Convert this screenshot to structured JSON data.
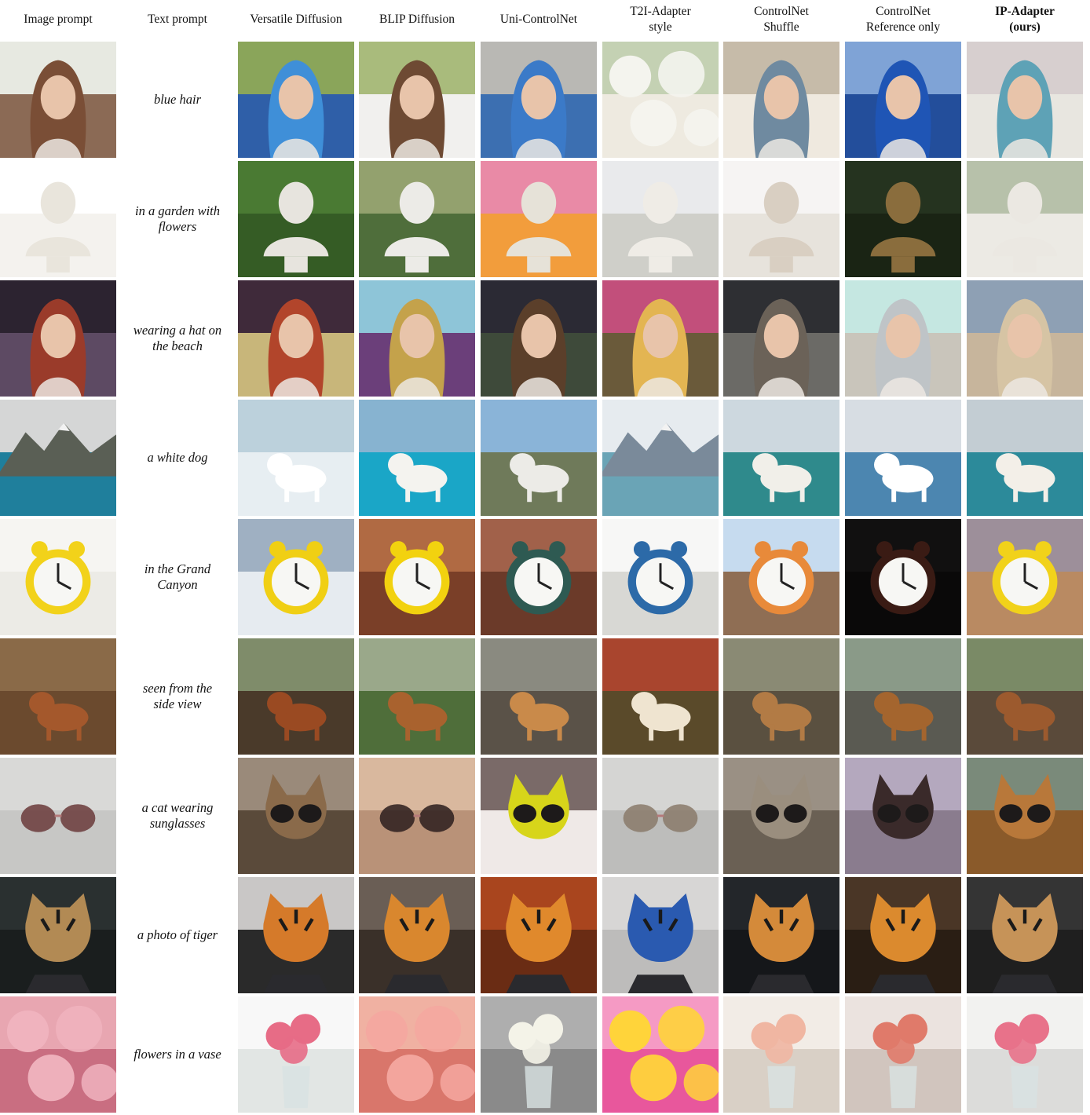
{
  "headers": [
    "Image prompt",
    "Text prompt",
    "Versatile Diffusion",
    "BLIP Diffusion",
    "Uni-ControlNet",
    "T2I-Adapter\nstyle",
    "ControlNet\nShuffle",
    "ControlNet\nReference only",
    "IP-Adapter\n(ours)"
  ],
  "rows": [
    {
      "prompt": "blue hair",
      "tiles": [
        {
          "bg": "#c9cfc0",
          "sky": "#e7e9e1",
          "ground": "#8b6a55",
          "shape": "face",
          "sc": "#7a4e36"
        },
        {
          "bg": "#6e8a4c",
          "sky": "#8aa55a",
          "ground": "#2f5fa8",
          "shape": "face",
          "sc": "#3f8fd8"
        },
        {
          "bg": "#7e9a59",
          "sky": "#a9bb7c",
          "ground": "#f1f0ee",
          "shape": "face",
          "sc": "#6e4a33"
        },
        {
          "bg": "#8a8a88",
          "sky": "#b9b8b4",
          "ground": "#3c6fb1",
          "shape": "face",
          "sc": "#3b7ac8"
        },
        {
          "bg": "#d8ddcf",
          "sky": "#c4d1b3",
          "ground": "#eeeae0",
          "shape": "flowers",
          "sc": "#f4f4ee"
        },
        {
          "bg": "#9b9283",
          "sky": "#c6bba9",
          "ground": "#efe9df",
          "shape": "face",
          "sc": "#6f8aa0"
        },
        {
          "bg": "#5d86c4",
          "sky": "#7fa3d6",
          "ground": "#234e9b",
          "shape": "face",
          "sc": "#1f55b5"
        },
        {
          "bg": "#9eae90",
          "sky": "#d7cfcf",
          "ground": "#e8e6e0",
          "shape": "face",
          "sc": "#5ea2b6"
        }
      ]
    },
    {
      "prompt": "in a garden with\nflowers",
      "tiles": [
        {
          "bg": "#ffffff",
          "sky": "#ffffff",
          "ground": "#f4f2ee",
          "shape": "bust",
          "sc": "#e9e5dc"
        },
        {
          "bg": "#3f6b2b",
          "sky": "#4a7a33",
          "ground": "#355c25",
          "shape": "bust",
          "sc": "#e7e4de"
        },
        {
          "bg": "#6b8a4c",
          "sky": "#93a16e",
          "ground": "#4f6e3b",
          "shape": "bust",
          "sc": "#ecebe7"
        },
        {
          "bg": "#2f5e24",
          "sky": "#e98aa6",
          "ground": "#f29d3c",
          "shape": "bust",
          "sc": "#e6e2d8"
        },
        {
          "bg": "#d7d9dc",
          "sky": "#e9eaec",
          "ground": "#cfcfc9",
          "shape": "bust",
          "sc": "#efece6"
        },
        {
          "bg": "#f2f0ee",
          "sky": "#f6f4f3",
          "ground": "#e7e3dc",
          "shape": "bust",
          "sc": "#d9cfc2"
        },
        {
          "bg": "#1d2a18",
          "sky": "#25331f",
          "ground": "#1a2414",
          "shape": "bust",
          "sc": "#8a6d3d"
        },
        {
          "bg": "#8a9b7a",
          "sky": "#b7c1aa",
          "ground": "#eceae4",
          "shape": "bust",
          "sc": "#ebe8e2"
        }
      ]
    },
    {
      "prompt": "wearing a hat on\nthe beach",
      "tiles": [
        {
          "bg": "#3c2f3e",
          "sky": "#2c2330",
          "ground": "#5d4a63",
          "shape": "face",
          "sc": "#9a3b2a"
        },
        {
          "bg": "#6b4a5a",
          "sky": "#3f2a3a",
          "ground": "#c8b67a",
          "shape": "face",
          "sc": "#b2452b"
        },
        {
          "bg": "#6aa0c4",
          "sky": "#8ec5d8",
          "ground": "#6b3f7a",
          "shape": "face",
          "sc": "#c4a24b"
        },
        {
          "bg": "#4e5a6a",
          "sky": "#2b2a34",
          "ground": "#3e4a3a",
          "shape": "face",
          "sc": "#5b3f2a"
        },
        {
          "bg": "#8a4a6a",
          "sky": "#c24f7b",
          "ground": "#6a5a3a",
          "shape": "face",
          "sc": "#e3b552"
        },
        {
          "bg": "#4a4a48",
          "sky": "#2e2f33",
          "ground": "#6b6a66",
          "shape": "face",
          "sc": "#6b6258"
        },
        {
          "bg": "#a6d6d0",
          "sky": "#c5e7e1",
          "ground": "#c9c5bb",
          "shape": "face",
          "sc": "#bfc4c7"
        },
        {
          "bg": "#9a8c7a",
          "sky": "#8ea0b4",
          "ground": "#c7b59c",
          "shape": "face",
          "sc": "#d6c4a4"
        }
      ]
    },
    {
      "prompt": "a white dog",
      "tiles": [
        {
          "bg": "#c9cbcd",
          "sky": "#d5d6d6",
          "ground": "#1f7f9c",
          "shape": "mountain",
          "sc": "#5a5f55"
        },
        {
          "bg": "#3b8aa8",
          "sky": "#bcd1dc",
          "ground": "#e7eef2",
          "shape": "dog",
          "sc": "#ffffff"
        },
        {
          "bg": "#2d6b45",
          "sky": "#87b3d0",
          "ground": "#1aa6c7",
          "shape": "dog",
          "sc": "#f4f3ef"
        },
        {
          "bg": "#5b8a3a",
          "sky": "#8ab4d8",
          "ground": "#6f7a5a",
          "shape": "dog",
          "sc": "#ecebe7"
        },
        {
          "bg": "#d3dbe2",
          "sky": "#e6ebef",
          "ground": "#6aa4b6",
          "shape": "mountain",
          "sc": "#7a8a9a"
        },
        {
          "bg": "#7a8f5a",
          "sky": "#cdd8df",
          "ground": "#2f8a8c",
          "shape": "dog",
          "sc": "#f1efe9"
        },
        {
          "bg": "#6e8fb3",
          "sky": "#d7dde3",
          "ground": "#4c86b0",
          "shape": "dog",
          "sc": "#ffffff"
        },
        {
          "bg": "#6e9a5a",
          "sky": "#c3cdd3",
          "ground": "#2c8a9a",
          "shape": "dog",
          "sc": "#f3efe8"
        }
      ]
    },
    {
      "prompt": "in the Grand\nCanyon",
      "tiles": [
        {
          "bg": "#f1f0ec",
          "sky": "#f6f5f2",
          "ground": "#ecebe6",
          "shape": "clock",
          "sc": "#f2d21a"
        },
        {
          "bg": "#c9d0d8",
          "sky": "#9fb0c2",
          "ground": "#e6ebf0",
          "shape": "clock",
          "sc": "#f0cf14"
        },
        {
          "bg": "#9a5a3a",
          "sky": "#b06a43",
          "ground": "#7a3f28",
          "shape": "clock",
          "sc": "#f2d20f"
        },
        {
          "bg": "#8a4f3a",
          "sky": "#a1614a",
          "ground": "#6b3a29",
          "shape": "clock",
          "sc": "#2e5a52"
        },
        {
          "bg": "#f3f3f1",
          "sky": "#f7f7f6",
          "ground": "#d8d8d4",
          "shape": "clock",
          "sc": "#2c6aa8"
        },
        {
          "bg": "#a5c7e6",
          "sky": "#c6dbef",
          "ground": "#8f6e54",
          "shape": "clock",
          "sc": "#e88a3a"
        },
        {
          "bg": "#0c0b0b",
          "sky": "#111010",
          "ground": "#0a0909",
          "shape": "clock",
          "sc": "#3a1b14"
        },
        {
          "bg": "#b6a6a6",
          "sky": "#9d8f9a",
          "ground": "#b98a62",
          "shape": "clock",
          "sc": "#f1d21a"
        }
      ]
    },
    {
      "prompt": "seen from the\nside view",
      "tiles": [
        {
          "bg": "#7a5a3a",
          "sky": "#8a6a48",
          "ground": "#6b4a2e",
          "shape": "dog",
          "sc": "#a4582c"
        },
        {
          "bg": "#5b6a4a",
          "sky": "#7f8c6a",
          "ground": "#4a3a2a",
          "shape": "dog",
          "sc": "#9a4a22"
        },
        {
          "bg": "#6a8a5a",
          "sky": "#9aa88a",
          "ground": "#4f6e3a",
          "shape": "dog",
          "sc": "#a9622e"
        },
        {
          "bg": "#6b6a62",
          "sky": "#8a8a80",
          "ground": "#5a5248",
          "shape": "dog",
          "sc": "#c98a4a"
        },
        {
          "bg": "#8a3a2a",
          "sky": "#a9452e",
          "ground": "#5a4a2a",
          "shape": "dog",
          "sc": "#efe4d0"
        },
        {
          "bg": "#6a6a58",
          "sky": "#8a8a74",
          "ground": "#5a5040",
          "shape": "dog",
          "sc": "#b27b45"
        },
        {
          "bg": "#6a7a6a",
          "sky": "#8a9a88",
          "ground": "#5a5a52",
          "shape": "dog",
          "sc": "#a4652e"
        },
        {
          "bg": "#5a6a4a",
          "sky": "#7a8a66",
          "ground": "#5a4a3a",
          "shape": "dog",
          "sc": "#9c5a2e"
        }
      ]
    },
    {
      "prompt": "a cat wearing\nsunglasses",
      "tiles": [
        {
          "bg": "#cfcfcd",
          "sky": "#d9d9d7",
          "ground": "#c7c7c5",
          "shape": "glasses",
          "sc": "#6a3a3a"
        },
        {
          "bg": "#7a6a5a",
          "sky": "#9a8a7a",
          "ground": "#5a4a3a",
          "shape": "cat",
          "sc": "#8a6a4a"
        },
        {
          "bg": "#c7a78f",
          "sky": "#d9b89e",
          "ground": "#b99278",
          "shape": "glasses",
          "sc": "#2b1d1d"
        },
        {
          "bg": "#5a4a48",
          "sky": "#7a6a68",
          "ground": "#efe9e7",
          "shape": "cat",
          "sc": "#d7d51a"
        },
        {
          "bg": "#c9c9c7",
          "sky": "#d5d5d3",
          "ground": "#bdbdbb",
          "shape": "glasses",
          "sc": "#8a7a6a"
        },
        {
          "bg": "#7a7064",
          "sky": "#9a9084",
          "ground": "#6a6054",
          "shape": "cat",
          "sc": "#9a8e7e"
        },
        {
          "bg": "#9c8fa6",
          "sky": "#b4a8be",
          "ground": "#8a7c8e",
          "shape": "cat",
          "sc": "#3a2a2a"
        },
        {
          "bg": "#5a6a5a",
          "sky": "#7a8a7a",
          "ground": "#8a5a2a",
          "shape": "cat",
          "sc": "#b8783a"
        }
      ]
    },
    {
      "prompt": "a photo of tiger",
      "tiles": [
        {
          "bg": "#1f2424",
          "sky": "#2a3030",
          "ground": "#1a1e1e",
          "shape": "tiger",
          "sc": "#b28a54"
        },
        {
          "bg": "#b7b5b4",
          "sky": "#c9c7c6",
          "ground": "#2a2a2a",
          "shape": "tiger",
          "sc": "#d57a2a"
        },
        {
          "bg": "#5a5048",
          "sky": "#6a5e55",
          "ground": "#3a3029",
          "shape": "tiger",
          "sc": "#d9872e"
        },
        {
          "bg": "#8a3a1a",
          "sky": "#a9451e",
          "ground": "#6a2c14",
          "shape": "tiger",
          "sc": "#e0892c"
        },
        {
          "bg": "#c7c6c5",
          "sky": "#d7d6d5",
          "ground": "#bdbcbb",
          "shape": "tiger",
          "sc": "#2a5ab0"
        },
        {
          "bg": "#1a1c1e",
          "sky": "#23262a",
          "ground": "#15171a",
          "shape": "tiger",
          "sc": "#d48a3a"
        },
        {
          "bg": "#3a2a1e",
          "sky": "#4a3626",
          "ground": "#2a1e14",
          "shape": "tiger",
          "sc": "#db8a2e"
        },
        {
          "bg": "#2a2a2a",
          "sky": "#343434",
          "ground": "#1f1f1f",
          "shape": "tiger",
          "sc": "#c69358"
        }
      ]
    },
    {
      "prompt": "flowers in a vase",
      "tiles": [
        {
          "bg": "#d98a9a",
          "sky": "#e8a6b1",
          "ground": "#c96e81",
          "shape": "flowers",
          "sc": "#f0b3be"
        },
        {
          "bg": "#f3f3f3",
          "sky": "#f8f8f8",
          "ground": "#e2e6e4",
          "shape": "vase",
          "sc": "#e76c86"
        },
        {
          "bg": "#e79a8a",
          "sky": "#f0b1a2",
          "ground": "#d9766b",
          "shape": "flowers",
          "sc": "#f4a8a0"
        },
        {
          "bg": "#9a9a9a",
          "sky": "#aeaeae",
          "ground": "#8a8a8a",
          "shape": "vase",
          "sc": "#f4f3e8"
        },
        {
          "bg": "#f07ab2",
          "sky": "#f59ac4",
          "ground": "#e8579c",
          "shape": "flowers",
          "sc": "#ffd43a"
        },
        {
          "bg": "#e9e2da",
          "sky": "#f2ece6",
          "ground": "#d9d0c6",
          "shape": "vase",
          "sc": "#f0b6a2"
        },
        {
          "bg": "#e1d7d2",
          "sky": "#ebe3df",
          "ground": "#d1c5be",
          "shape": "vase",
          "sc": "#e07a6a"
        },
        {
          "bg": "#ececea",
          "sky": "#f2f2f0",
          "ground": "#dcdcda",
          "shape": "vase",
          "sc": "#e8728a"
        }
      ]
    }
  ]
}
